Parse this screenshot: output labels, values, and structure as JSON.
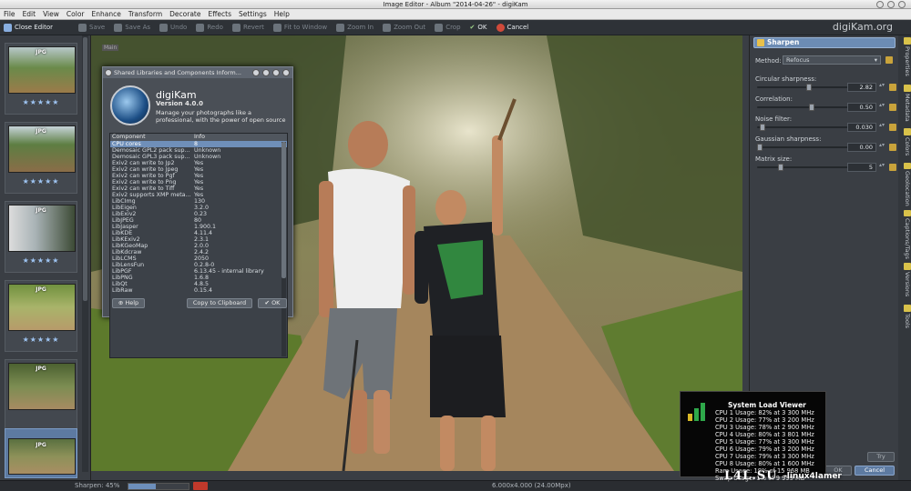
{
  "window": {
    "title": "Image Editor - Album \"2014-04-26\" - digiKam"
  },
  "menu": [
    "File",
    "Edit",
    "View",
    "Color",
    "Enhance",
    "Transform",
    "Decorate",
    "Effects",
    "Settings",
    "Help"
  ],
  "toolbar": {
    "close_editor": "Close Editor",
    "items": [
      "Save",
      "Save As",
      "Undo",
      "Redo",
      "Revert",
      "Fit to Window",
      "Zoom In",
      "Zoom Out",
      "Crop"
    ],
    "ok": "OK",
    "cancel": "Cancel",
    "brand": "digiKam.org"
  },
  "canvas_label": "Main",
  "thumbnails": [
    {
      "format": "JPG",
      "stars": "★★★★★"
    },
    {
      "format": "JPG",
      "stars": "★★★★★"
    },
    {
      "format": "JPG",
      "stars": "★★★★★"
    },
    {
      "format": "JPG",
      "stars": "★★★★★"
    },
    {
      "format": "JPG",
      "stars": ""
    },
    {
      "format": "JPG",
      "stars": ""
    }
  ],
  "dialog": {
    "title": "Shared Libraries and Components Inform...",
    "app_name": "digiKam",
    "version": "Version 4.0.0",
    "description": "Manage your photographs like a professional, with the power of open source",
    "columns": [
      "Component",
      "Info"
    ],
    "rows": [
      [
        "CPU cores",
        "8"
      ],
      [
        "Demosaic GPL2 pack sup...",
        "Unknown"
      ],
      [
        "Demosaic GPL3 pack sup...",
        "Unknown"
      ],
      [
        "Exiv2 can write to Jp2",
        "Yes"
      ],
      [
        "Exiv2 can write to Jpeg",
        "Yes"
      ],
      [
        "Exiv2 can write to Pgf",
        "Yes"
      ],
      [
        "Exiv2 can write to Png",
        "Yes"
      ],
      [
        "Exiv2 can write to Tiff",
        "Yes"
      ],
      [
        "Exiv2 supports XMP meta...",
        "Yes"
      ],
      [
        "LibCImg",
        "130"
      ],
      [
        "LibEigen",
        "3.2.0"
      ],
      [
        "LibExiv2",
        "0.23"
      ],
      [
        "LibJPEG",
        "80"
      ],
      [
        "LibJasper",
        "1.900.1"
      ],
      [
        "LibKDE",
        "4.11.4"
      ],
      [
        "LibKExiv2",
        "2.3.1"
      ],
      [
        "LibKGeoMap",
        "2.0.0"
      ],
      [
        "LibKdcraw",
        "2.4.2"
      ],
      [
        "LibLCMS",
        "2050"
      ],
      [
        "LibLensFun",
        "0.2.8-0"
      ],
      [
        "LibPGF",
        "6.13.45 - internal library"
      ],
      [
        "LibPNG",
        "1.6.8"
      ],
      [
        "LibQt",
        "4.8.5"
      ],
      [
        "LibRaw",
        "0.15.4"
      ]
    ],
    "help": "Help",
    "copy": "Copy to Clipboard",
    "ok": "OK"
  },
  "sharpen": {
    "title": "Sharpen",
    "method_label": "Method:",
    "method_value": "Refocus",
    "params": [
      {
        "label": "Circular sharpness:",
        "value": "2.82",
        "level": 0.47
      },
      {
        "label": "Correlation:",
        "value": "0.50",
        "level": 0.5
      },
      {
        "label": "Noise filter:",
        "value": "0.030",
        "level": 0.03
      },
      {
        "label": "Gaussian sharpness:",
        "value": "0.00",
        "level": 0.0
      },
      {
        "label": "Matrix size:",
        "value": "5",
        "level": 0.2
      }
    ],
    "try": "Try",
    "ok": "OK",
    "cancel": "Cancel"
  },
  "side_tabs": [
    "Properties",
    "Metadata",
    "Colors",
    "Geolocation",
    "Captions/Tags",
    "Versions",
    "Tools"
  ],
  "status": {
    "left": "Sharpen: 45%",
    "center": "6.000x4.000 (24.00Mpx)"
  },
  "sysload": {
    "title": "System Load Viewer",
    "lines": [
      "CPU 1 Usage: 82% at 3 300 MHz",
      "CPU 2 Usage: 77% at 3 200 MHz",
      "CPU 3 Usage: 78% at 2 900 MHz",
      "CPU 4 Usage: 80% at 3 801 MHz",
      "CPU 5 Usage: 77% at 3 300 MHz",
      "CPU 6 Usage: 79% at 3 200 MHz",
      "CPU 7 Usage: 79% at 3 300 MHz",
      "CPU 8 Usage: 80% at 1 600 MHz",
      "Ram Usage: 18% of 15 968 MB",
      "Swap Usage: 1% of 9 999 MB"
    ]
  },
  "watermark": {
    "text1": "L4L.SU",
    "text2": "-linux4lamer"
  }
}
